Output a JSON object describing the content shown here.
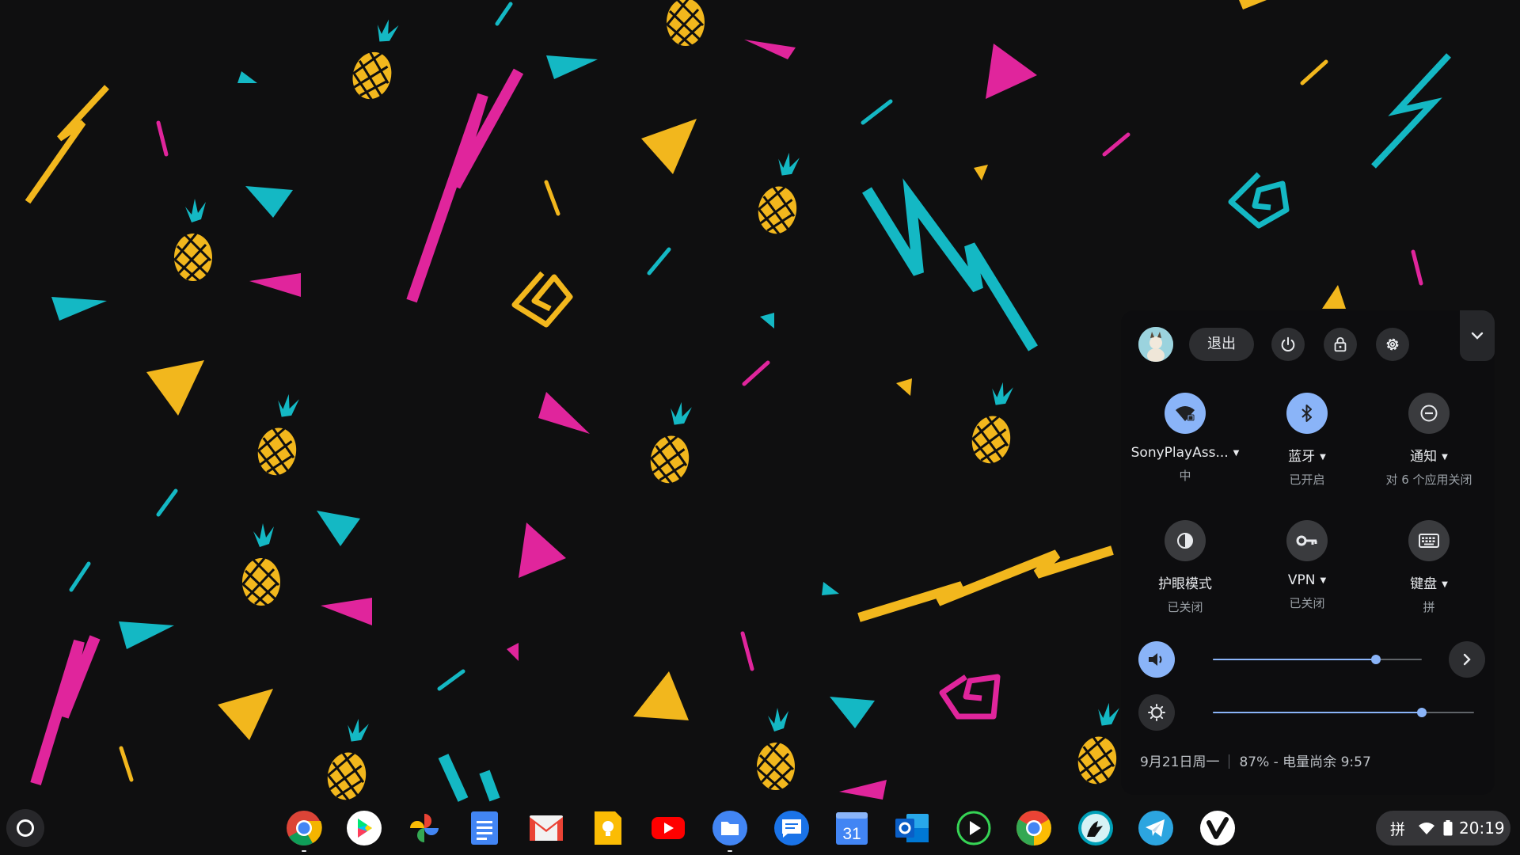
{
  "quick_settings": {
    "signout_label": "退出",
    "tiles": [
      {
        "label": "SonyPlayAss...",
        "sublabel": "中",
        "state": "on",
        "has_menu": true,
        "icon": "wifi-locked-icon"
      },
      {
        "label": "蓝牙",
        "sublabel": "已开启",
        "state": "on",
        "has_menu": true,
        "icon": "bluetooth-icon"
      },
      {
        "label": "通知",
        "sublabel": "对 6 个应用关闭",
        "state": "off",
        "has_menu": true,
        "icon": "do-not-disturb-icon"
      },
      {
        "label": "护眼模式",
        "sublabel": "已关闭",
        "state": "off",
        "has_menu": false,
        "icon": "night-light-icon"
      },
      {
        "label": "VPN",
        "sublabel": "已关闭",
        "state": "off",
        "has_menu": true,
        "icon": "vpn-key-icon"
      },
      {
        "label": "键盘",
        "sublabel": "拼",
        "state": "off",
        "has_menu": true,
        "icon": "keyboard-icon"
      }
    ],
    "volume_level": 0.78,
    "brightness_level": 0.8,
    "footer": {
      "date": "9月21日周一",
      "battery_text": "87% - 电量尚余 9:57"
    }
  },
  "shelf": {
    "apps": [
      {
        "name": "chrome",
        "icon": "chrome-icon",
        "running": true
      },
      {
        "name": "play-store",
        "icon": "play-store-icon",
        "running": false
      },
      {
        "name": "photos",
        "icon": "photos-icon",
        "running": false
      },
      {
        "name": "docs",
        "icon": "docs-icon",
        "running": false
      },
      {
        "name": "gmail",
        "icon": "gmail-icon",
        "running": false
      },
      {
        "name": "keep",
        "icon": "keep-icon",
        "running": false
      },
      {
        "name": "youtube",
        "icon": "youtube-icon",
        "running": false
      },
      {
        "name": "files",
        "icon": "files-icon",
        "running": true
      },
      {
        "name": "messages",
        "icon": "messages-icon",
        "running": false
      },
      {
        "name": "calendar",
        "icon": "calendar-icon",
        "running": false,
        "label": "31"
      },
      {
        "name": "outlook",
        "icon": "outlook-icon",
        "running": false
      },
      {
        "name": "player",
        "icon": "media-player-icon",
        "running": false
      },
      {
        "name": "chrome-canary",
        "icon": "chrome-color-icon",
        "running": false
      },
      {
        "name": "reader",
        "icon": "reader-icon",
        "running": false
      },
      {
        "name": "telegram",
        "icon": "telegram-icon",
        "running": false
      },
      {
        "name": "vivaldi",
        "icon": "vivaldi-icon",
        "running": false
      }
    ],
    "tray": {
      "ime": "拼",
      "time": "20:19"
    }
  },
  "colors": {
    "wallpaper_bg": "#0f0f10",
    "pink": "#e0259c",
    "teal": "#14b8c4",
    "yellow": "#f2b71d",
    "accent": "#8ab4f8"
  }
}
